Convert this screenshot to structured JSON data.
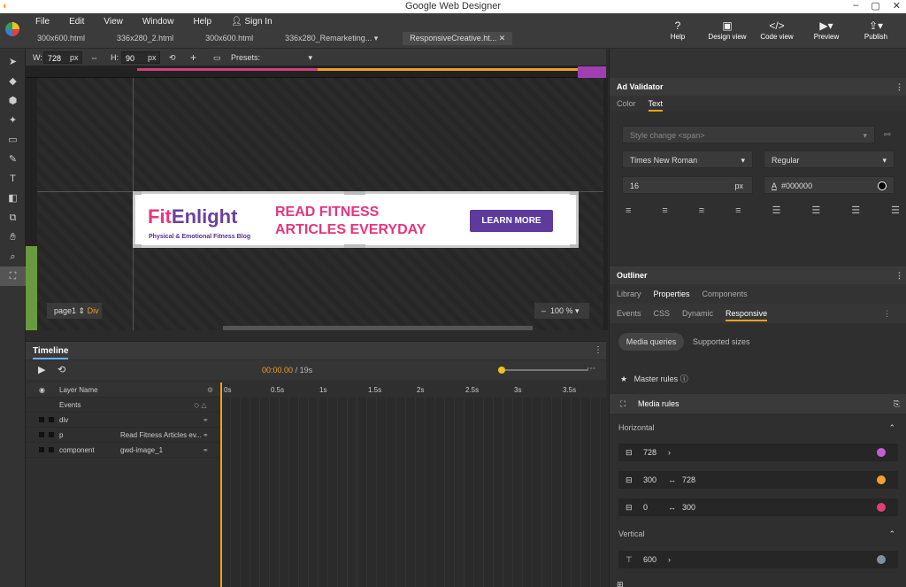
{
  "window": {
    "title": "Google Web Designer",
    "controls": [
      "–",
      "▢",
      "✕"
    ]
  },
  "menu": [
    "File",
    "Edit",
    "View",
    "Window",
    "Help",
    "Sign In"
  ],
  "tabs": [
    "300x600.html",
    "336x280_2.html",
    "300x600.html",
    "336x280_Remarketing...",
    "ResponsiveCreative.ht..."
  ],
  "topbuttons": {
    "help": "Help",
    "design": "Design view",
    "code": "Code view",
    "preview": "Preview",
    "publish": "Publish"
  },
  "toolbar": {
    "w_label": "W:",
    "w_value": "728",
    "w_unit": "px",
    "h_label": "H:",
    "h_value": "90",
    "h_unit": "px",
    "presets": "Presets:"
  },
  "ad": {
    "logo_fit": "Fit",
    "logo_rest": "Enlight",
    "tagline": "Physical & Emotional Fitness Blog",
    "headline1": "READ FITNESS",
    "headline2": "ARTICLES EVERYDAY",
    "cta": "LEARN MORE"
  },
  "stage": {
    "page": "page1",
    "element": "Div",
    "zoom": "100 %"
  },
  "timeline": {
    "title": "Timeline",
    "time_current": "00:00.00",
    "time_total": "/ 19s",
    "ticks": [
      "0s",
      "0.5s",
      "1s",
      "1.5s",
      "2s",
      "2.5s",
      "3s",
      "3.5s"
    ],
    "layer_header": "Layer Name",
    "layers": [
      {
        "name": "Events",
        "value": ""
      },
      {
        "name": "div",
        "value": ""
      },
      {
        "name": "p",
        "value": "Read Fitness Articles ev..."
      },
      {
        "name": "component",
        "value": "gwd-image_1"
      }
    ]
  },
  "panel": {
    "validator": "Ad Validator",
    "color_tab": "Color",
    "text_tab": "Text",
    "style_change": "Style change <span>",
    "font": "Times New Roman",
    "weight": "Regular",
    "size": "16",
    "size_unit": "px",
    "color": "#000000",
    "outliner": "Outliner",
    "tabs1": [
      "Library",
      "Properties",
      "Components"
    ],
    "tabs2": [
      "Events",
      "CSS",
      "Dynamic",
      "Responsive"
    ],
    "sub_tabs": [
      "Media queries",
      "Supported sizes"
    ],
    "master": "Master rules",
    "media": "Media rules",
    "horizontal": "Horizontal",
    "vertical": "Vertical",
    "h_rules": [
      {
        "min": "728",
        "max": "",
        "color": "#c060d0"
      },
      {
        "min": "300",
        "max": "728",
        "color": "#f0a030"
      },
      {
        "min": "0",
        "max": "300",
        "color": "#e04070"
      }
    ],
    "v_rules": [
      {
        "min": "600",
        "max": "",
        "color": "#8090a0"
      }
    ]
  }
}
